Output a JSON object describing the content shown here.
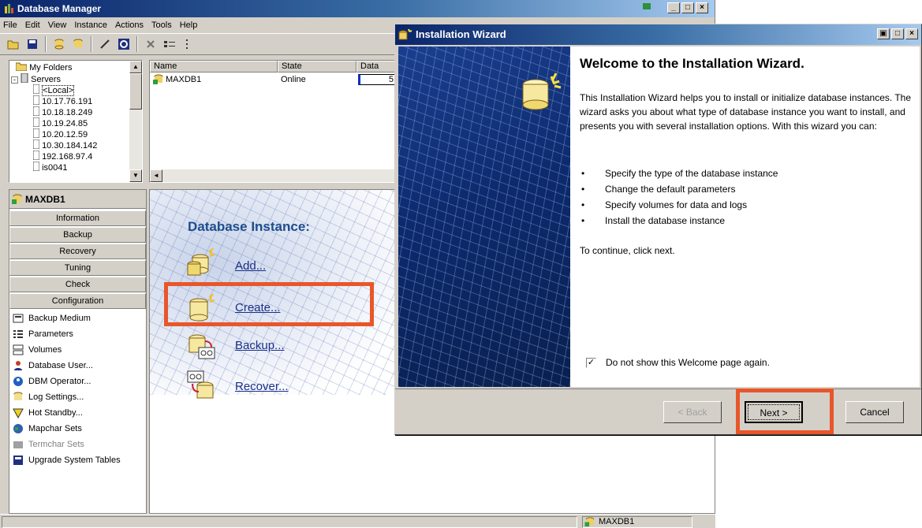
{
  "main": {
    "title": "Database Manager",
    "menu": [
      "File",
      "Edit",
      "View",
      "Instance",
      "Actions",
      "Tools",
      "Help"
    ],
    "tree": {
      "items": [
        "My Folders",
        "Servers",
        "<Local>",
        "10.17.76.191",
        "10.18.18.249",
        "10.19.24.85",
        "10.20.12.59",
        "10.30.184.142",
        "192.168.97.4",
        "is0041"
      ]
    },
    "list": {
      "headers": [
        "Name",
        "State",
        "Data"
      ],
      "rows": [
        {
          "name": "MAXDB1",
          "state": "Online",
          "data": "5"
        }
      ]
    },
    "left_panel": {
      "header": "MAXDB1",
      "sections": [
        "Information",
        "Backup",
        "Recovery",
        "Tuning",
        "Check",
        "Configuration"
      ],
      "items": [
        "Backup Medium",
        "Parameters",
        "Volumes",
        "Database User...",
        "DBM Operator...",
        "Log Settings...",
        "Hot Standby...",
        "Mapchar Sets",
        "Termchar Sets",
        "Upgrade System Tables"
      ]
    },
    "content": {
      "title": "Database Instance:",
      "links": [
        "Add...",
        "Create...",
        "Backup...",
        "Recover..."
      ]
    },
    "status": {
      "instance": "MAXDB1"
    }
  },
  "wizard": {
    "title": "Installation Wizard",
    "heading": "Welcome to the Installation Wizard.",
    "intro": "This Installation Wizard helps you to install or initialize database instances. The wizard asks you about what type of database instance you want to install, and presents you with several installation options. With this wizard you can:",
    "bullets": [
      "Specify the type of the database instance",
      "Change the default parameters",
      "Specify volumes for data and logs",
      "Install the database instance"
    ],
    "continue": "To continue, click next.",
    "checkbox_label": "Do not show this Welcome page again.",
    "buttons": {
      "back": "< Back",
      "next": "Next >",
      "cancel": "Cancel"
    }
  },
  "colors": {
    "highlight": "#e8562a",
    "title_blue": "#0a246a",
    "link": "#1a2f8a"
  }
}
